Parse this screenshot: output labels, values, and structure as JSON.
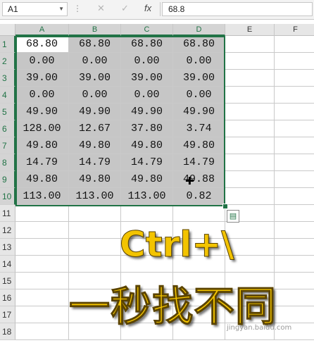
{
  "name_box": "A1",
  "formula_value": "68.8",
  "formula_buttons": {
    "cancel": "✕",
    "enter": "✓",
    "fx": "fx"
  },
  "columns": [
    "A",
    "B",
    "C",
    "D",
    "E",
    "F"
  ],
  "rows": [
    "1",
    "2",
    "3",
    "4",
    "5",
    "6",
    "7",
    "8",
    "9",
    "10",
    "11",
    "12",
    "13",
    "14",
    "15",
    "16",
    "17",
    "18"
  ],
  "cells": [
    [
      "68.80",
      "68.80",
      "68.80",
      "68.80"
    ],
    [
      "0.00",
      "0.00",
      "0.00",
      "0.00"
    ],
    [
      "39.00",
      "39.00",
      "39.00",
      "39.00"
    ],
    [
      "0.00",
      "0.00",
      "0.00",
      "0.00"
    ],
    [
      "49.90",
      "49.90",
      "49.90",
      "49.90"
    ],
    [
      "128.00",
      "12.67",
      "37.80",
      "3.74"
    ],
    [
      "49.80",
      "49.80",
      "49.80",
      "49.80"
    ],
    [
      "14.79",
      "14.79",
      "14.79",
      "14.79"
    ],
    [
      "49.80",
      "49.80",
      "49.80",
      "49.88"
    ],
    [
      "113.00",
      "113.00",
      "113.00",
      "0.82"
    ]
  ],
  "overlay": {
    "shortcut": "Ctrl+\\",
    "caption": "一秒找不同"
  },
  "watermark": "jingyan.baidu.com",
  "colors": {
    "accent": "#217346",
    "selection_fill": "#c6c6c6",
    "overlay_text": "#f3c400"
  }
}
